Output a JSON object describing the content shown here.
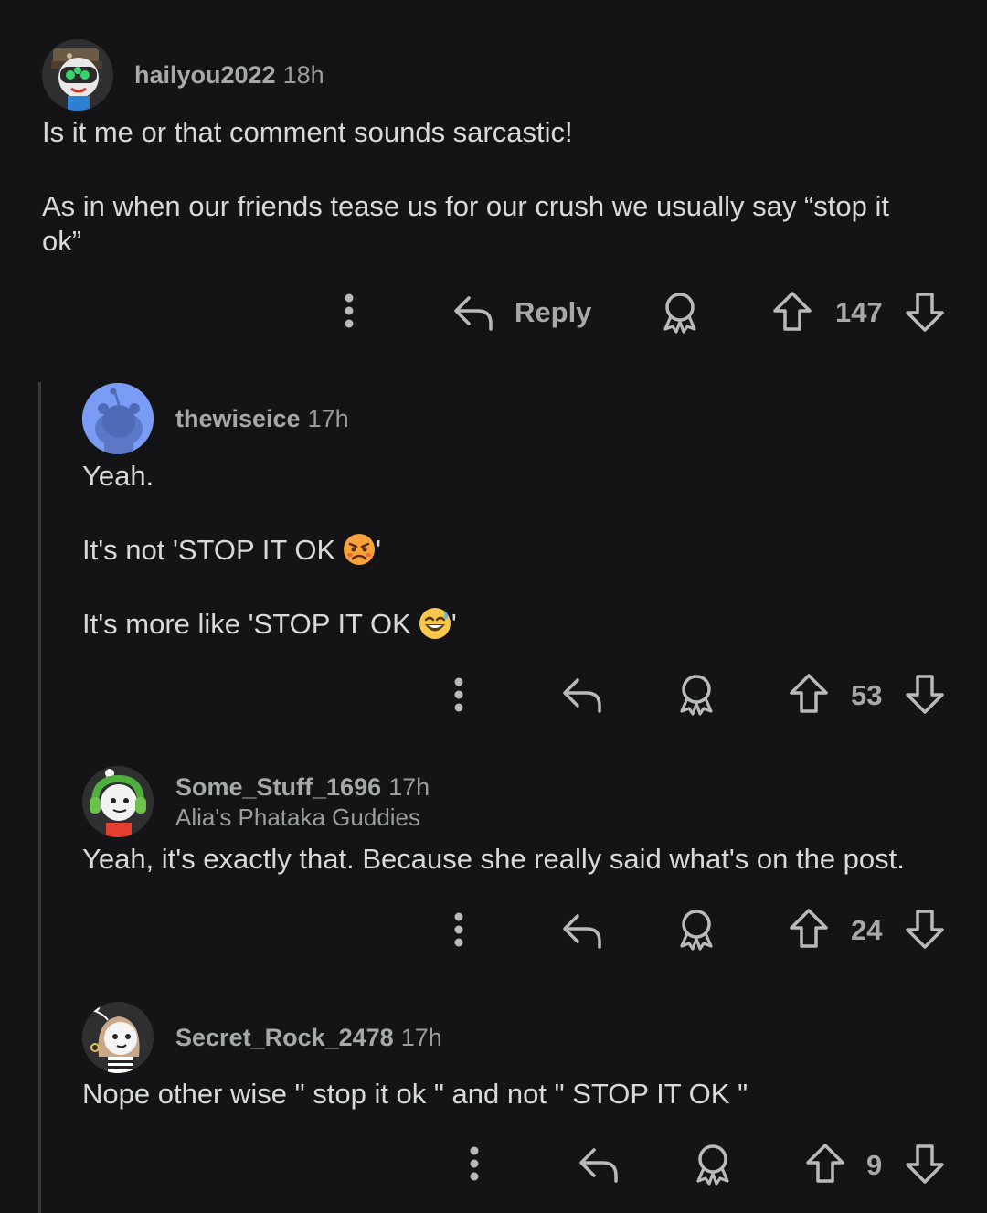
{
  "comments": [
    {
      "username": "hailyou2022",
      "time": "18h",
      "lines": [
        "Is it me or that comment sounds sarcastic!",
        "As in when our friends tease us for our crush we usually say “stop it",
        "ok”"
      ],
      "reply_label": "Reply",
      "votes": "147"
    },
    {
      "username": "thewiseice",
      "time": "17h",
      "lines": [
        "Yeah.",
        "It's not 'STOP IT OK",
        "'",
        "It's more like 'STOP IT OK",
        "'"
      ],
      "votes": "53"
    },
    {
      "username": "Some_Stuff_1696",
      "time": "17h",
      "flair": "Alia's Phataka Guddies",
      "lines": [
        "Yeah, it's exactly that. Because she really said what's on the post."
      ],
      "votes": "24"
    },
    {
      "username": "Secret_Rock_2478",
      "time": "17h",
      "lines": [
        "Nope other wise \" stop it ok \" and not \" STOP IT OK \""
      ],
      "votes": "9"
    }
  ],
  "colors": {
    "background": "#141416",
    "text": "#d7dadc",
    "meta": "#9a9d9f",
    "thread_line": "#3a3a3c"
  },
  "icons": [
    "more-icon",
    "reply-icon",
    "award-icon",
    "upvote-icon",
    "downvote-icon",
    "angry-emoji",
    "sweat-smile-emoji"
  ]
}
